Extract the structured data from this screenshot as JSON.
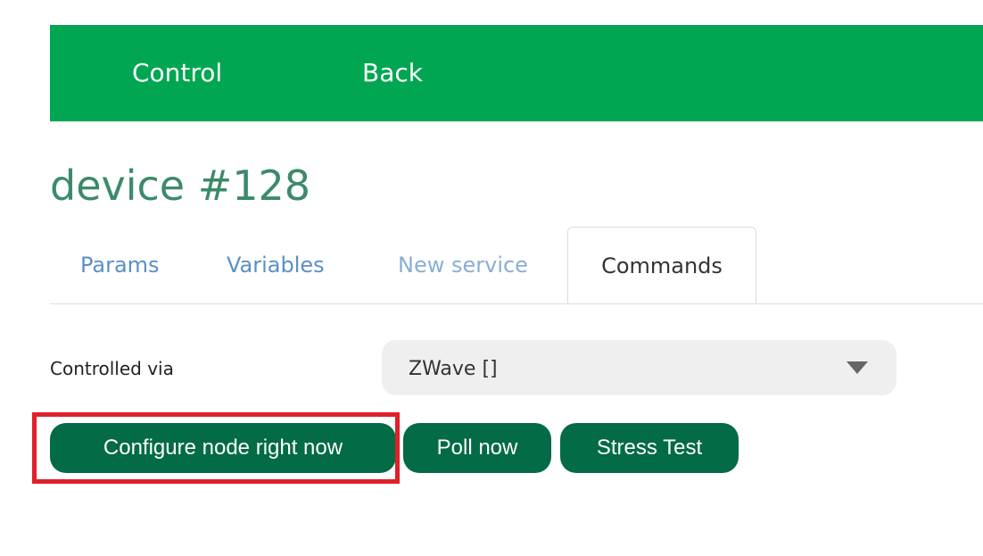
{
  "nav": {
    "control_label": "Control",
    "back_label": "Back"
  },
  "page": {
    "title": "device #128"
  },
  "tabs": [
    {
      "label": "Params"
    },
    {
      "label": "Variables"
    },
    {
      "label": "New service"
    },
    {
      "label": "Commands",
      "active": true
    }
  ],
  "controlled_via": {
    "label": "Controlled via",
    "selected_value": "ZWave []"
  },
  "actions": {
    "configure_label": "Configure node right now",
    "poll_label": "Poll now",
    "stress_label": "Stress Test"
  },
  "colors": {
    "topbar": "#00a651",
    "button": "#036b45",
    "title": "#3c8a69",
    "tab_link": "#5b8fc7",
    "highlight": "#e0202a"
  }
}
